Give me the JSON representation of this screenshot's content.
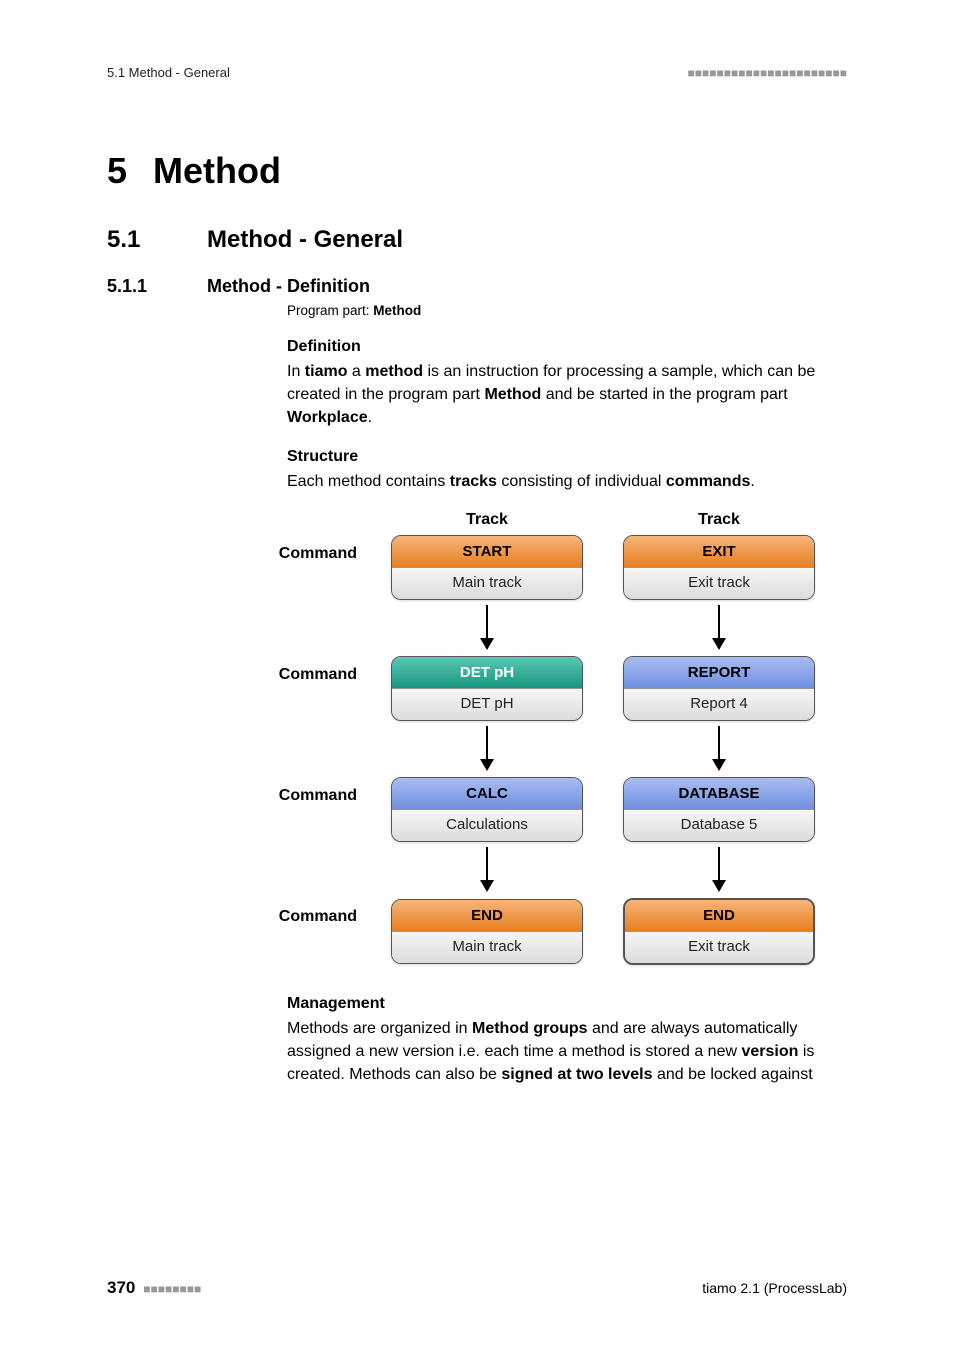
{
  "header": {
    "left": "5.1 Method - General"
  },
  "h1": {
    "num": "5",
    "text": "Method"
  },
  "h2": {
    "num": "5.1",
    "text": "Method - General"
  },
  "h3": {
    "num": "5.1.1",
    "text": "Method - Definition"
  },
  "programpart": {
    "prefix": "Program part: ",
    "bold": "Method"
  },
  "def": {
    "head": "Definition",
    "p_a": "In ",
    "p_b": "tiamo",
    "p_c": " a ",
    "p_d": "method",
    "p_e": " is an instruction for processing a sample, which can be created in the program part ",
    "p_f": "Method",
    "p_g": " and be started in the program part ",
    "p_h": "Workplace",
    "p_i": "."
  },
  "struct": {
    "head": "Structure",
    "p_a": "Each method contains ",
    "p_b": "tracks",
    "p_c": " consisting of individual ",
    "p_d": "commands",
    "p_e": "."
  },
  "diagram": {
    "trackLabel": "Track",
    "commandLabel": "Command",
    "left": [
      {
        "top": "START",
        "bot": "Main track"
      },
      {
        "top": "DET pH",
        "bot": "DET pH"
      },
      {
        "top": "CALC",
        "bot": "Calculations"
      },
      {
        "top": "END",
        "bot": "Main track"
      }
    ],
    "right": [
      {
        "top": "EXIT",
        "bot": "Exit track"
      },
      {
        "top": "REPORT",
        "bot": "Report 4"
      },
      {
        "top": "DATABASE",
        "bot": "Database 5"
      },
      {
        "top": "END",
        "bot": "Exit track"
      }
    ]
  },
  "mgmt": {
    "head": "Management",
    "p_a": "Methods are organized in ",
    "p_b": "Method groups",
    "p_c": " and are always automatically assigned a new version i.e. each time a method is stored a new ",
    "p_d": "version",
    "p_e": " is created. Methods can also be ",
    "p_f": "signed at two levels",
    "p_g": " and be locked against"
  },
  "footer": {
    "page": "370",
    "right": "tiamo 2.1 (ProcessLab)"
  }
}
